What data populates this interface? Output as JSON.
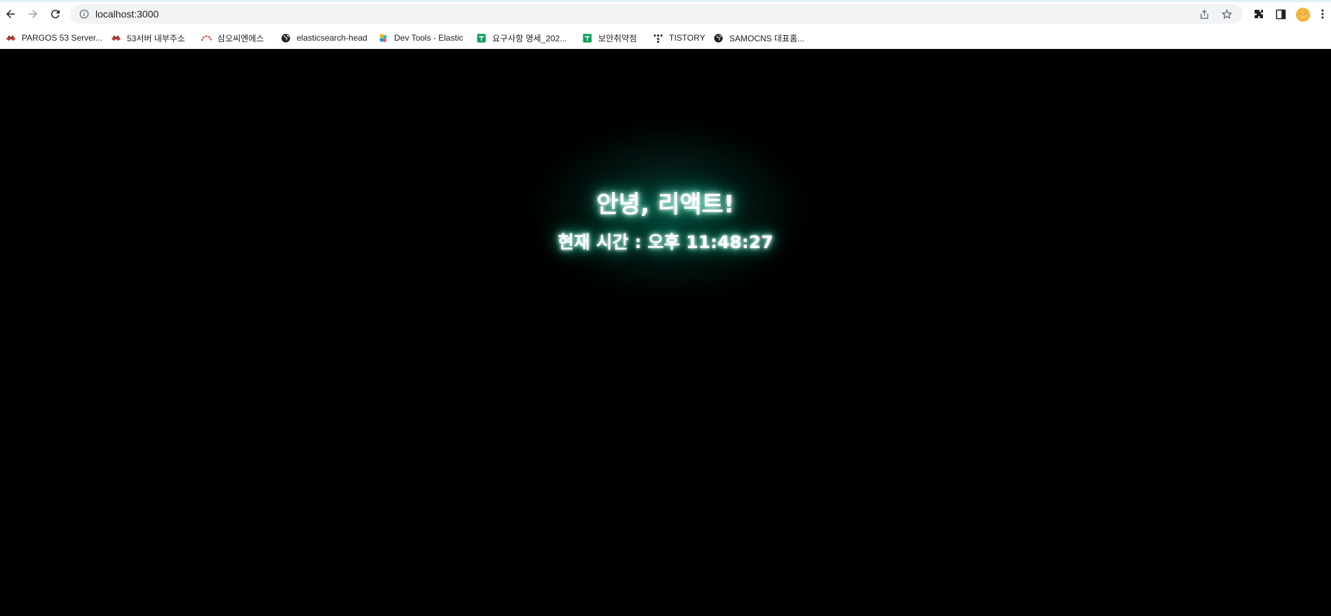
{
  "browser": {
    "url": "localhost:3000",
    "icons": {
      "back": "back-arrow-icon",
      "forward": "forward-arrow-icon",
      "reload": "reload-icon",
      "info": "info-icon",
      "share": "share-icon",
      "bookmark_star": "star-icon",
      "extensions": "puzzle-icon",
      "side_panel": "side-panel-icon",
      "profile": "profile-avatar-icon",
      "menu": "kebab-menu-icon"
    }
  },
  "bookmarks": [
    {
      "label": "PARGOS 53 Server...",
      "icon": "pargos-icon"
    },
    {
      "label": "53서버 내부주소",
      "icon": "pargos-icon"
    },
    {
      "label": "삼오씨엔에스",
      "icon": "samo-logo-icon"
    },
    {
      "label": "elasticsearch-head",
      "icon": "globe-icon"
    },
    {
      "label": "Dev Tools - Elastic",
      "icon": "elastic-icon"
    },
    {
      "label": "요구사항 명세_202...",
      "icon": "sheets-icon"
    },
    {
      "label": "보안취약점",
      "icon": "sheets-icon"
    },
    {
      "label": "TISTORY",
      "icon": "tistory-icon"
    },
    {
      "label": "SAMOCNS 대표홈...",
      "icon": "globe-icon"
    }
  ],
  "page": {
    "title": "안녕, 리액트!",
    "clock_text": "현재 시간 : 오후 11:48:27"
  },
  "colors": {
    "background": "#000000",
    "glow": "#2fd3a8",
    "text": "#ffffff"
  }
}
